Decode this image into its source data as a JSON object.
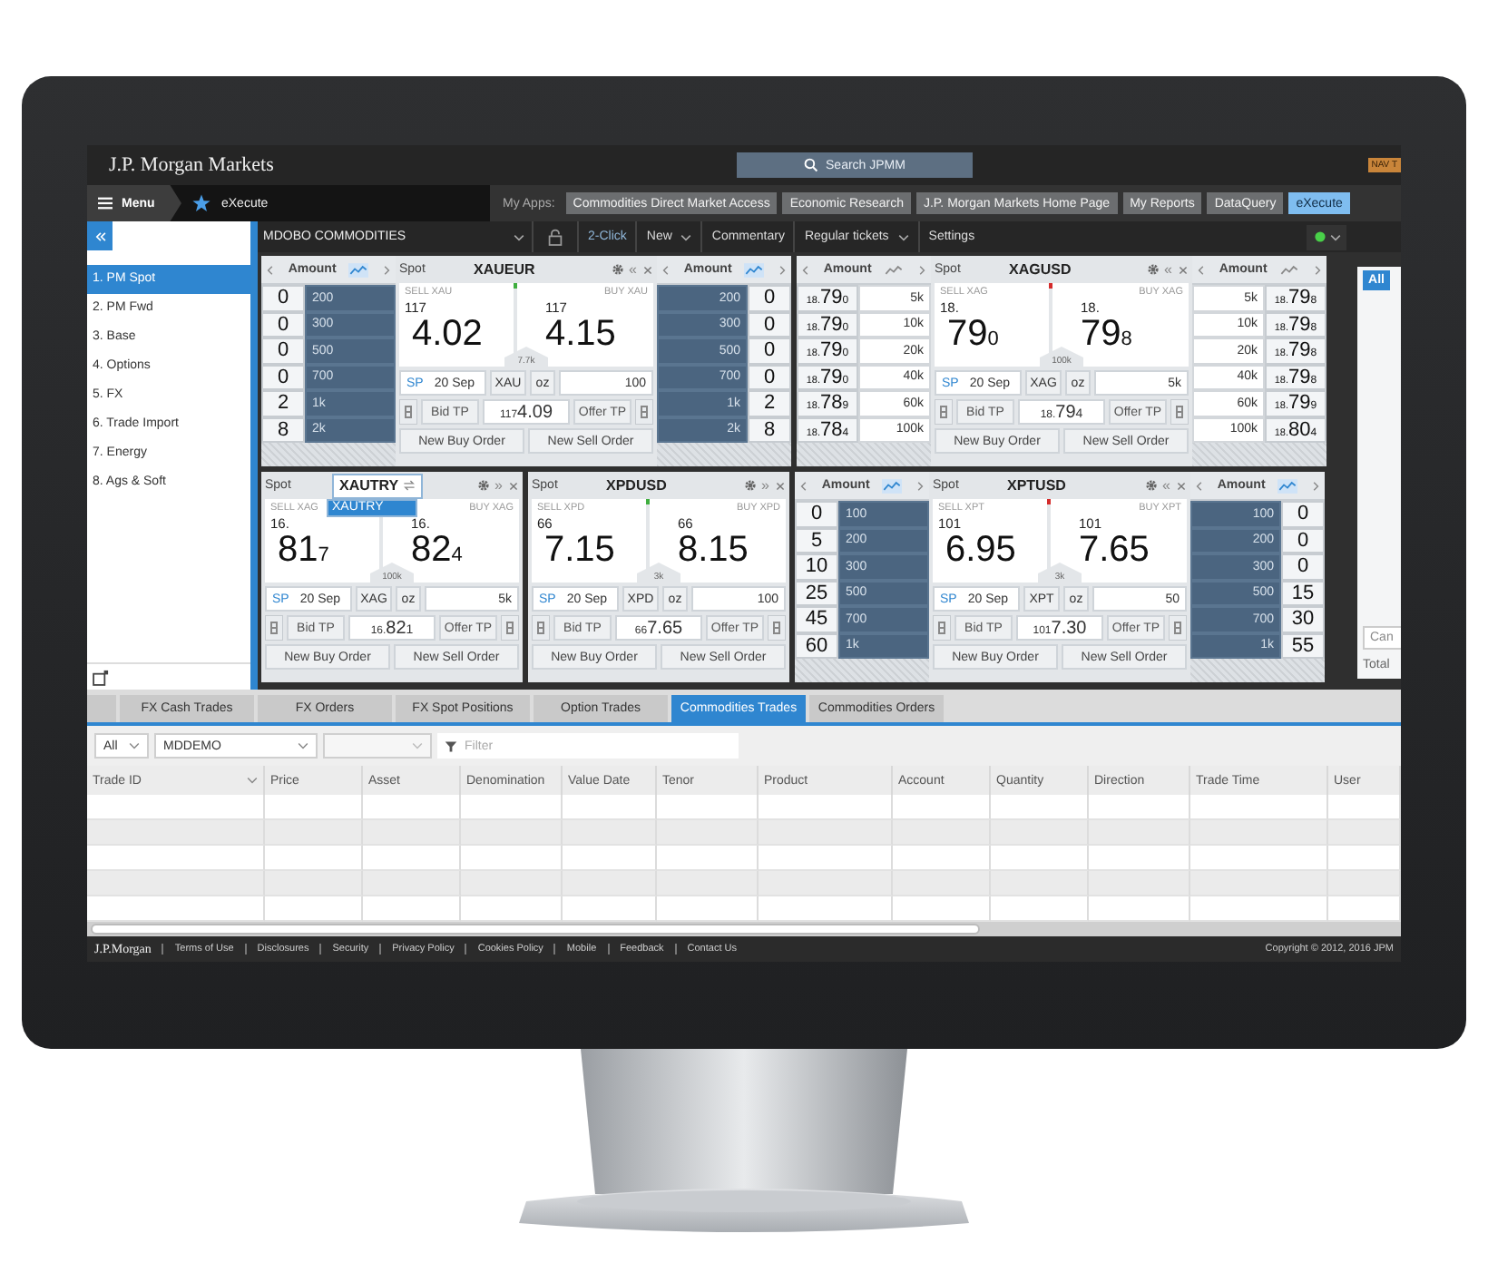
{
  "header": {
    "logo": "J.P. Morgan Markets",
    "search": "Search JPMM",
    "badge": "NAV T"
  },
  "nav": {
    "menu": "Menu",
    "app_name": "eXecute",
    "my_apps_label": "My Apps:",
    "apps": [
      {
        "label": "Commodities Direct Market Access",
        "selected": false
      },
      {
        "label": "Economic Research",
        "selected": false
      },
      {
        "label": "J.P. Morgan Markets Home Page",
        "selected": false
      },
      {
        "label": "My Reports",
        "selected": false
      },
      {
        "label": "DataQuery",
        "selected": false
      },
      {
        "label": "eXecute",
        "selected": true
      }
    ]
  },
  "sidebar": {
    "items": [
      {
        "label": "1. PM Spot",
        "selected": true
      },
      {
        "label": "2. PM Fwd",
        "selected": false
      },
      {
        "label": "3. Base",
        "selected": false
      },
      {
        "label": "4. Options",
        "selected": false
      },
      {
        "label": "5. FX",
        "selected": false
      },
      {
        "label": "6. Trade Import",
        "selected": false
      },
      {
        "label": "7. Energy",
        "selected": false
      },
      {
        "label": "8. Ags & Soft",
        "selected": false
      }
    ]
  },
  "toolbar": {
    "workspace": "MDOBO COMMODITIES",
    "items": [
      {
        "label": "2-Click",
        "kind": "toggle"
      },
      {
        "label": "New",
        "kind": "menu"
      },
      {
        "label": "Commentary",
        "kind": "button"
      },
      {
        "label": "Regular tickets",
        "kind": "menu"
      },
      {
        "label": "Settings",
        "kind": "button"
      }
    ]
  },
  "tile_rows": [
    {
      "tiles": [
        {
          "left_ladder": {
            "title": "Amount",
            "depth": true,
            "rows": [
              {
                "value": {
                  "big": "0"
                },
                "size": "200"
              },
              {
                "value": {
                  "big": "0"
                },
                "size": "300"
              },
              {
                "value": {
                  "big": "0"
                },
                "size": "500"
              },
              {
                "value": {
                  "big": "0"
                },
                "size": "700"
              },
              {
                "value": {
                  "big": "2"
                },
                "size": "1k"
              },
              {
                "value": {
                  "big": "8"
                },
                "size": "2k"
              }
            ]
          },
          "ticket": {
            "label": "Spot",
            "symbol": "XAUEUR",
            "editing": false,
            "collapse": "«",
            "indicator": {
              "color": "#3fae3f"
            },
            "sell_label": "SELL XAU",
            "buy_label": "BUY XAU",
            "sell": {
              "pre": "117",
              "big": "4.02"
            },
            "buy": {
              "pre": "117",
              "big": "4.15"
            },
            "spread": "7.7k",
            "tenor": "SP",
            "date": "20 Sep",
            "asset": "XAU",
            "unit": "oz",
            "amount": "100",
            "bid_tp": "Bid TP",
            "mid": {
              "pre": "117",
              "big": "4.09"
            },
            "offer_tp": "Offer TP",
            "buy_order": "New Buy Order",
            "sell_order": "New Sell Order"
          },
          "right_ladder": {
            "title": "Amount",
            "depth": true,
            "rows": [
              {
                "value": {
                  "big": "0"
                },
                "size": "200"
              },
              {
                "value": {
                  "big": "0"
                },
                "size": "300"
              },
              {
                "value": {
                  "big": "0"
                },
                "size": "500"
              },
              {
                "value": {
                  "big": "0"
                },
                "size": "700"
              },
              {
                "value": {
                  "big": "2"
                },
                "size": "1k"
              },
              {
                "value": {
                  "big": "8"
                },
                "size": "2k"
              }
            ]
          }
        },
        {
          "left_ladder": {
            "title": "Amount",
            "depth": false,
            "rows": [
              {
                "value": {
                  "pre": "18.",
                  "big": "79",
                  "pip": "0"
                },
                "size": "5k"
              },
              {
                "value": {
                  "pre": "18.",
                  "big": "79",
                  "pip": "0"
                },
                "size": "10k"
              },
              {
                "value": {
                  "pre": "18.",
                  "big": "79",
                  "pip": "0"
                },
                "size": "20k"
              },
              {
                "value": {
                  "pre": "18.",
                  "big": "79",
                  "pip": "0"
                },
                "size": "40k"
              },
              {
                "value": {
                  "pre": "18.",
                  "big": "78",
                  "pip": "9"
                },
                "size": "60k"
              },
              {
                "value": {
                  "pre": "18.",
                  "big": "78",
                  "pip": "4"
                },
                "size": "100k"
              }
            ]
          },
          "ticket": {
            "label": "Spot",
            "symbol": "XAGUSD",
            "editing": false,
            "collapse": "«",
            "indicator": {
              "color": "#d42b2b"
            },
            "sell_label": "SELL XAG",
            "buy_label": "BUY XAG",
            "sell": {
              "pre": "18.",
              "big": "79",
              "pip": "0"
            },
            "buy": {
              "pre": "18.",
              "big": "79",
              "pip": "8"
            },
            "spread": "100k",
            "tenor": "SP",
            "date": "20 Sep",
            "asset": "XAG",
            "unit": "oz",
            "amount": "5k",
            "bid_tp": "Bid TP",
            "mid": {
              "pre": "18.",
              "big": "79",
              "pip": "4"
            },
            "offer_tp": "Offer TP",
            "buy_order": "New Buy Order",
            "sell_order": "New Sell Order"
          },
          "right_ladder": {
            "title": "Amount",
            "depth": false,
            "rows": [
              {
                "value": {
                  "pre": "18.",
                  "big": "79",
                  "pip": "8"
                },
                "size": "5k"
              },
              {
                "value": {
                  "pre": "18.",
                  "big": "79",
                  "pip": "8"
                },
                "size": "10k"
              },
              {
                "value": {
                  "pre": "18.",
                  "big": "79",
                  "pip": "8"
                },
                "size": "20k"
              },
              {
                "value": {
                  "pre": "18.",
                  "big": "79",
                  "pip": "8"
                },
                "size": "40k"
              },
              {
                "value": {
                  "pre": "18.",
                  "big": "79",
                  "pip": "9"
                },
                "size": "60k"
              },
              {
                "value": {
                  "pre": "18.",
                  "big": "80",
                  "pip": "4"
                },
                "size": "100k"
              }
            ]
          }
        }
      ]
    },
    {
      "tiles": [
        {
          "ticket": {
            "label": "Spot",
            "symbol": "XAUTRY",
            "editing": true,
            "suggestions": [
              {
                "label": "XAUTRY",
                "selected": true
              }
            ],
            "collapse": "»",
            "sell_label": "SELL XAG",
            "buy_label": "BUY XAG",
            "sell": {
              "pre": "16.",
              "big": "81",
              "pip": "7"
            },
            "buy": {
              "pre": "16.",
              "big": "82",
              "pip": "4"
            },
            "spread": "100k",
            "tenor": "SP",
            "date": "20 Sep",
            "asset": "XAG",
            "unit": "oz",
            "amount": "5k",
            "bid_tp": "Bid TP",
            "mid": {
              "pre": "16.",
              "big": "82",
              "pip": "1"
            },
            "offer_tp": "Offer TP",
            "buy_order": "New Buy Order",
            "sell_order": "New Sell Order"
          }
        },
        {
          "ticket": {
            "label": "Spot",
            "symbol": "XPDUSD",
            "editing": false,
            "collapse": "»",
            "indicator": {
              "color": "#3fae3f"
            },
            "sell_label": "SELL XPD",
            "buy_label": "BUY XPD",
            "sell": {
              "pre": "66",
              "big": "7.15"
            },
            "buy": {
              "pre": "66",
              "big": "8.15"
            },
            "spread": "3k",
            "tenor": "SP",
            "date": "20 Sep",
            "asset": "XPD",
            "unit": "oz",
            "amount": "100",
            "bid_tp": "Bid TP",
            "mid": {
              "pre": "66",
              "big": "7.65"
            },
            "offer_tp": "Offer TP",
            "buy_order": "New Buy Order",
            "sell_order": "New Sell Order"
          }
        },
        {
          "left_ladder": {
            "title": "Amount",
            "depth": true,
            "rows": [
              {
                "value": {
                  "big": "0"
                },
                "size": "100"
              },
              {
                "value": {
                  "big": "5"
                },
                "size": "200"
              },
              {
                "value": {
                  "big": "10"
                },
                "size": "300"
              },
              {
                "value": {
                  "big": "25"
                },
                "size": "500"
              },
              {
                "value": {
                  "big": "45"
                },
                "size": "700"
              },
              {
                "value": {
                  "big": "60"
                },
                "size": "1k"
              }
            ]
          },
          "ticket": {
            "label": "Spot",
            "symbol": "XPTUSD",
            "editing": false,
            "collapse": "«",
            "indicator": {
              "color": "#d42b2b"
            },
            "sell_label": "SELL XPT",
            "buy_label": "BUY XPT",
            "sell": {
              "pre": "101",
              "big": "6.95"
            },
            "buy": {
              "pre": "101",
              "big": "7.65"
            },
            "spread": "3k",
            "tenor": "SP",
            "date": "20 Sep",
            "asset": "XPT",
            "unit": "oz",
            "amount": "50",
            "bid_tp": "Bid TP",
            "mid": {
              "pre": "101",
              "big": "7.30"
            },
            "offer_tp": "Offer TP",
            "buy_order": "New Buy Order",
            "sell_order": "New Sell Order"
          },
          "right_ladder": {
            "title": "Amount",
            "depth": true,
            "rows": [
              {
                "value": {
                  "big": "0"
                },
                "size": "100"
              },
              {
                "value": {
                  "big": "0"
                },
                "size": "200"
              },
              {
                "value": {
                  "big": "0"
                },
                "size": "300"
              },
              {
                "value": {
                  "big": "15"
                },
                "size": "500"
              },
              {
                "value": {
                  "big": "30"
                },
                "size": "700"
              },
              {
                "value": {
                  "big": "55"
                },
                "size": "1k"
              }
            ]
          }
        }
      ]
    }
  ],
  "side_panel": {
    "filter": "All",
    "cancel": "Can",
    "total": "Total"
  },
  "bottom_tabs": [
    {
      "label": "FX Cash Trades",
      "selected": false
    },
    {
      "label": "FX Orders",
      "selected": false
    },
    {
      "label": "FX Spot Positions",
      "selected": false
    },
    {
      "label": "Option Trades",
      "selected": false
    },
    {
      "label": "Commodities Trades",
      "selected": true
    },
    {
      "label": "Commodities Orders",
      "selected": false
    }
  ],
  "filters": {
    "scope": "All",
    "account": "MDDEMO",
    "filter_placeholder": "Filter"
  },
  "table": {
    "columns": [
      {
        "label": "Trade ID",
        "sorted": true
      },
      {
        "label": "Price",
        "sorted": false
      },
      {
        "label": "Asset",
        "sorted": false
      },
      {
        "label": "Denomination",
        "sorted": false
      },
      {
        "label": "Value Date",
        "sorted": false
      },
      {
        "label": "Tenor",
        "sorted": false
      },
      {
        "label": "Product",
        "sorted": false
      },
      {
        "label": "Account",
        "sorted": false
      },
      {
        "label": "Quantity",
        "sorted": false
      },
      {
        "label": "Direction",
        "sorted": false
      },
      {
        "label": "Trade Time",
        "sorted": false
      },
      {
        "label": "User",
        "sorted": false
      }
    ]
  },
  "footer": {
    "logo": "J.P.Morgan",
    "links": [
      "Terms of Use",
      "Disclosures",
      "Security",
      "Privacy Policy",
      "Cookies Policy",
      "Mobile",
      "Feedback",
      "Contact Us"
    ],
    "copyright": "Copyright © 2012, 2016 JPM"
  }
}
